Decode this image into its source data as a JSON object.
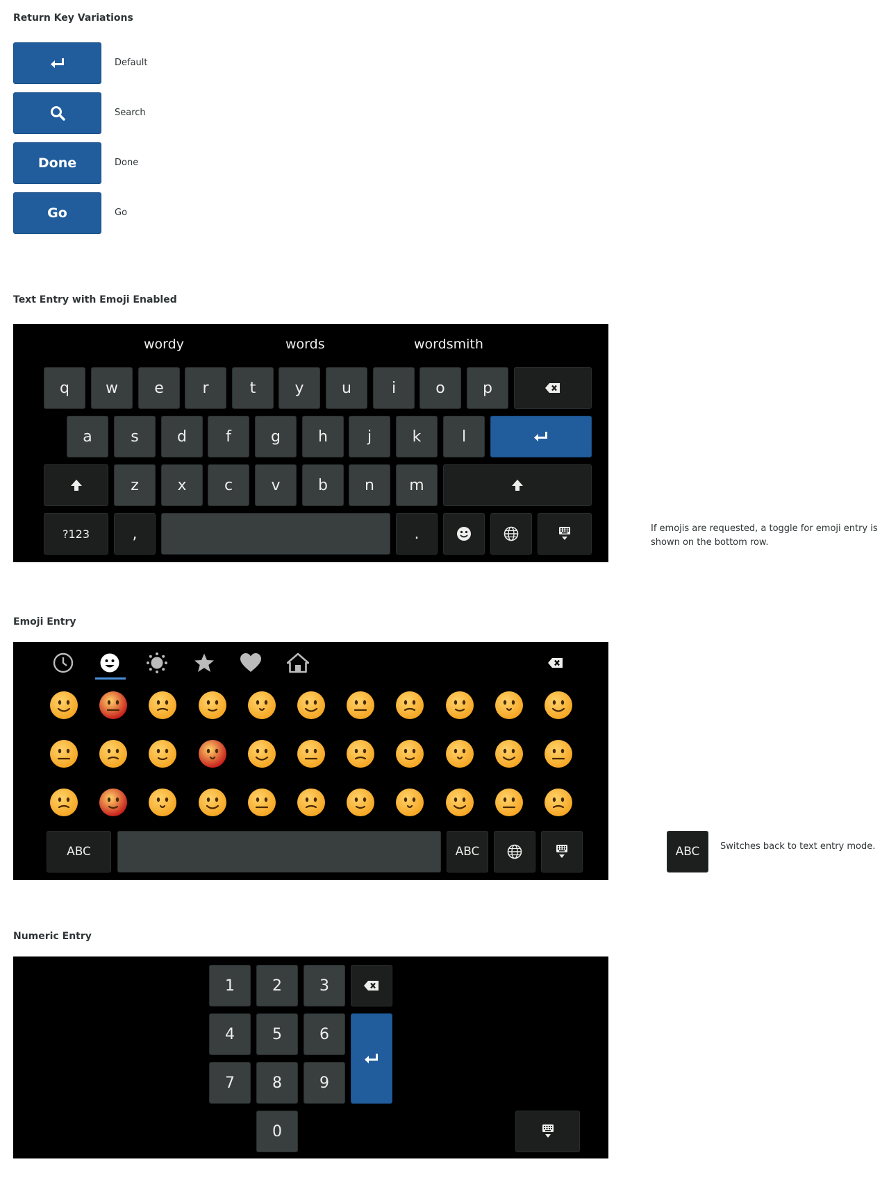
{
  "return_keys": {
    "title": "Return Key Variations",
    "items": [
      {
        "key": "enter-icon",
        "label": "Default"
      },
      {
        "key": "search-icon",
        "label": "Search"
      },
      {
        "key_text": "Done",
        "label": "Done"
      },
      {
        "key_text": "Go",
        "label": "Go"
      }
    ]
  },
  "text_entry": {
    "title": "Text Entry with Emoji Enabled",
    "suggestions": [
      "wordy",
      "words",
      "wordsmith"
    ],
    "row1": [
      "q",
      "w",
      "e",
      "r",
      "t",
      "y",
      "u",
      "i",
      "o",
      "p"
    ],
    "row2": [
      "a",
      "s",
      "d",
      "f",
      "g",
      "h",
      "j",
      "k",
      "l"
    ],
    "row3": [
      "z",
      "x",
      "c",
      "v",
      "b",
      "n",
      "m"
    ],
    "symbols_key": "?123",
    "comma_key": ",",
    "period_key": ".",
    "note": "If emojis are requested, a toggle for emoji entry is shown on the bottom row."
  },
  "emoji_entry": {
    "title": "Emoji Entry",
    "categories": [
      "recent-icon",
      "smileys-icon",
      "nature-icon",
      "symbols-icon",
      "love-icon",
      "places-icon"
    ],
    "abc_left": "ABC",
    "abc_right": "ABC",
    "callout_key": "ABC",
    "note": "Switches back to text entry mode."
  },
  "numeric_entry": {
    "title": "Numeric Entry",
    "keys": [
      "1",
      "2",
      "3",
      "4",
      "5",
      "6",
      "7",
      "8",
      "9",
      "0"
    ]
  },
  "colors": {
    "accent": "#215d9c",
    "key": "#393f3f",
    "key_dark": "#1d1f1f",
    "panel": "#000000",
    "emoji_face": "#f5a623"
  }
}
